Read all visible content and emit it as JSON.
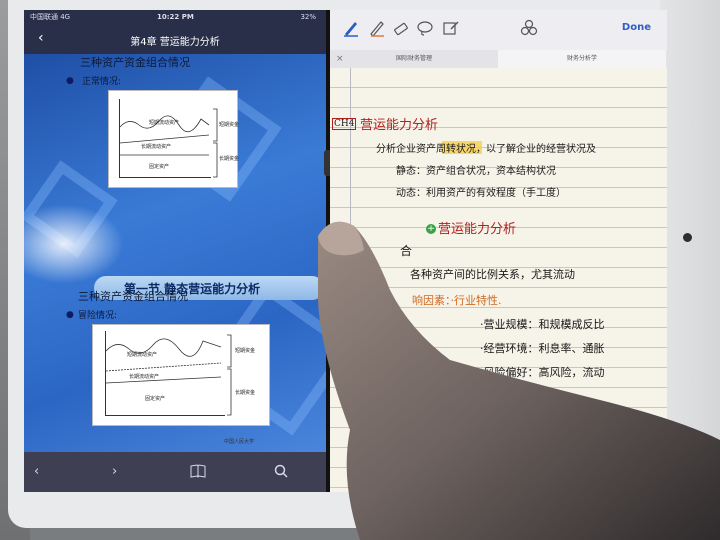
{
  "status_bar": {
    "carrier": "中国联通 4G",
    "time": "10:22 PM",
    "battery": "32%"
  },
  "pdf_viewer": {
    "title": "第4章  营运能力分析",
    "back_icon": "chevron-left-icon",
    "page_top": {
      "heading": "三种资产资金组合情况",
      "bullet_label": "正常情况:",
      "chart_labels": {
        "short_term_funds": "短期资金",
        "volatile_current_assets": "短期流动资产",
        "long_term_current_assets": "长期流动资产",
        "long_term_funds": "长期资金",
        "fixed_assets": "固定资产"
      }
    },
    "section_banner": "第一节  静态营运能力分析",
    "page_bottom": {
      "heading": "三种资产资金组合情况",
      "bullet_label": "冒险情况:",
      "chart_labels": {
        "short_term_funds": "短期资金",
        "volatile_current_assets": "短期流动资产",
        "long_term_current_assets": "长期流动资产",
        "long_term_funds": "长期资金",
        "fixed_assets": "固定资产"
      }
    },
    "footer": "中国人民大学",
    "bottom_toolbar": [
      "back-arrow-icon",
      "forward-arrow-icon",
      "book-icon",
      "search-icon"
    ]
  },
  "notes_app": {
    "toolbar_tools": [
      "pen-icon",
      "pencil-icon",
      "eraser-icon",
      "lasso-icon",
      "edit-icon",
      "shapes-icon"
    ],
    "done_label": "Done",
    "tabs": [
      {
        "label": "国际财务管理"
      },
      {
        "label": "财务分析学"
      }
    ],
    "handwriting": {
      "chapter_tag": "CH4",
      "chapter_title": "营运能力分析",
      "line1": "分析企业资产周转状况，以了解企业的经营状况及",
      "line2": "静态：资产组合状况，资本结构状况",
      "line3": "动态：利用资产的有效程度（手工度）",
      "section_title": "营运能力分析",
      "line5": "合",
      "line6": "各种资产间的比例关系，尤其流动",
      "line7": "响因素：·行业特性.",
      "line8": "·营业规模：和规模成反比",
      "line9": "·经营环境：利息率、通胀",
      "line10": "·风险偏好：高风险，流动"
    }
  },
  "colors": {
    "pdf_blue": "#2c66c4",
    "notes_red": "#b02020",
    "notes_orange": "#d2681e",
    "highlight": "#f5cd46",
    "done_blue": "#2f5fc8"
  }
}
